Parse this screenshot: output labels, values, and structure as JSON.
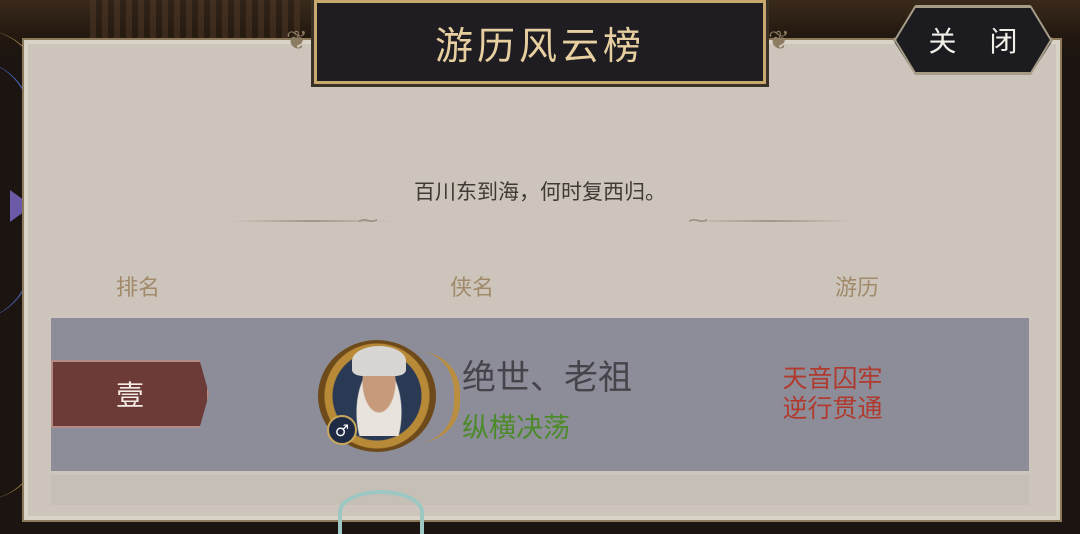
{
  "title": "游历风云榜",
  "close_button": "关 闭",
  "quote": "百川东到海，何时复西归。",
  "columns": {
    "rank": "排名",
    "name": "侠名",
    "experience": "游历"
  },
  "rows": [
    {
      "rank": "壹",
      "name": "绝世、老祖",
      "school": "纵横决荡",
      "gender_icon": "♂",
      "experience_line1": "天音囚牢",
      "experience_line2": "逆行贯通"
    }
  ],
  "colors": {
    "panel": "#cdc5bb",
    "row_highlight": "#8c8d98",
    "title_text": "#e7cfa0",
    "rank_tag": "#6d3b37",
    "school_green": "#4c8a2a",
    "experience_red": "#b13a2f",
    "notification_dot": "#e8413a"
  }
}
